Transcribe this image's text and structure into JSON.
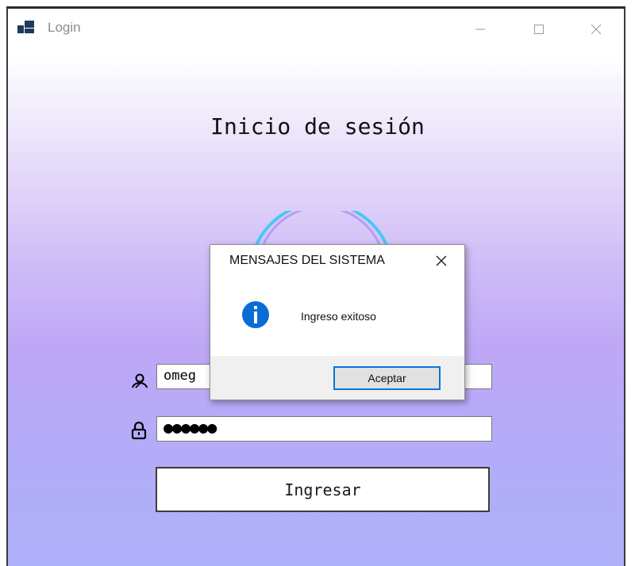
{
  "window": {
    "title": "Login",
    "icon": "app-window-icon"
  },
  "window_controls": {
    "minimize": "minimize-icon",
    "maximize": "maximize-icon",
    "close": "close-icon"
  },
  "form": {
    "heading": "Inicio de sesión",
    "username": {
      "icon": "user-icon",
      "value": "omeg"
    },
    "password": {
      "icon": "lock-icon",
      "value": "●●●●●●"
    },
    "submit_label": "Ingresar"
  },
  "dialog": {
    "title": "MENSAJES DEL SISTEMA",
    "message": "Ingreso exitoso",
    "icon": "info-icon",
    "ok_label": "Aceptar"
  },
  "colors": {
    "accent": "#0a74da",
    "info": "#0a6dd6",
    "gradient_bottom": "#aeb1f9"
  }
}
